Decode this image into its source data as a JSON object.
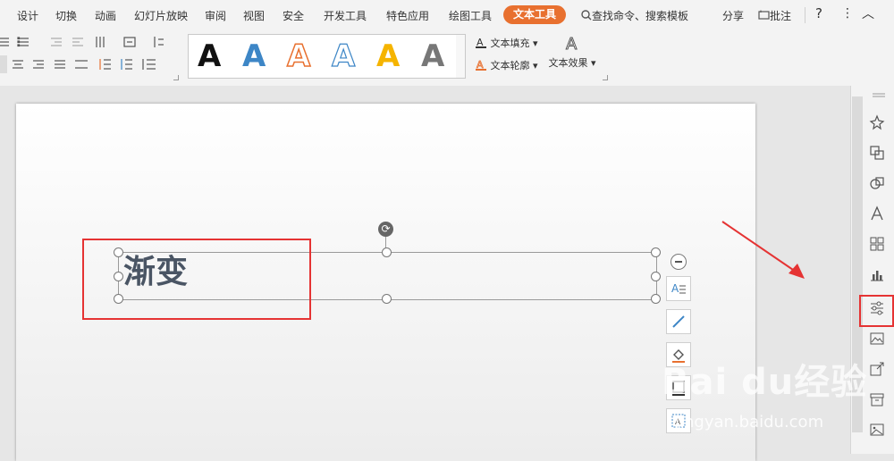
{
  "menu": {
    "tabs": [
      {
        "label": "设计"
      },
      {
        "label": "切换"
      },
      {
        "label": "动画"
      },
      {
        "label": "幻灯片放映"
      },
      {
        "label": "审阅"
      },
      {
        "label": "视图"
      },
      {
        "label": "安全"
      },
      {
        "label": "开发工具"
      },
      {
        "label": "特色应用"
      },
      {
        "label": "绘图工具"
      }
    ],
    "active_tab": "文本工具",
    "search": "查找命令、搜索模板",
    "share": "分享",
    "comment": "批注",
    "help": "?",
    "more": "⋮",
    "collapse": "︿"
  },
  "ribbon": {
    "text_fill": "文本填充",
    "text_outline": "文本轮廓",
    "text_effect": "文本效果",
    "styles_letter": "A",
    "style_colors": [
      "#111111",
      "#3d86c6",
      "#e8702f",
      "#ffffff",
      "#f5b400",
      "#777777"
    ]
  },
  "slide": {
    "text": "渐变"
  },
  "watermark": {
    "brand": "Bai du经验",
    "url": "jingyan.baidu.com"
  },
  "colors": {
    "accent": "#e8702f",
    "highlight": "#e53333"
  }
}
